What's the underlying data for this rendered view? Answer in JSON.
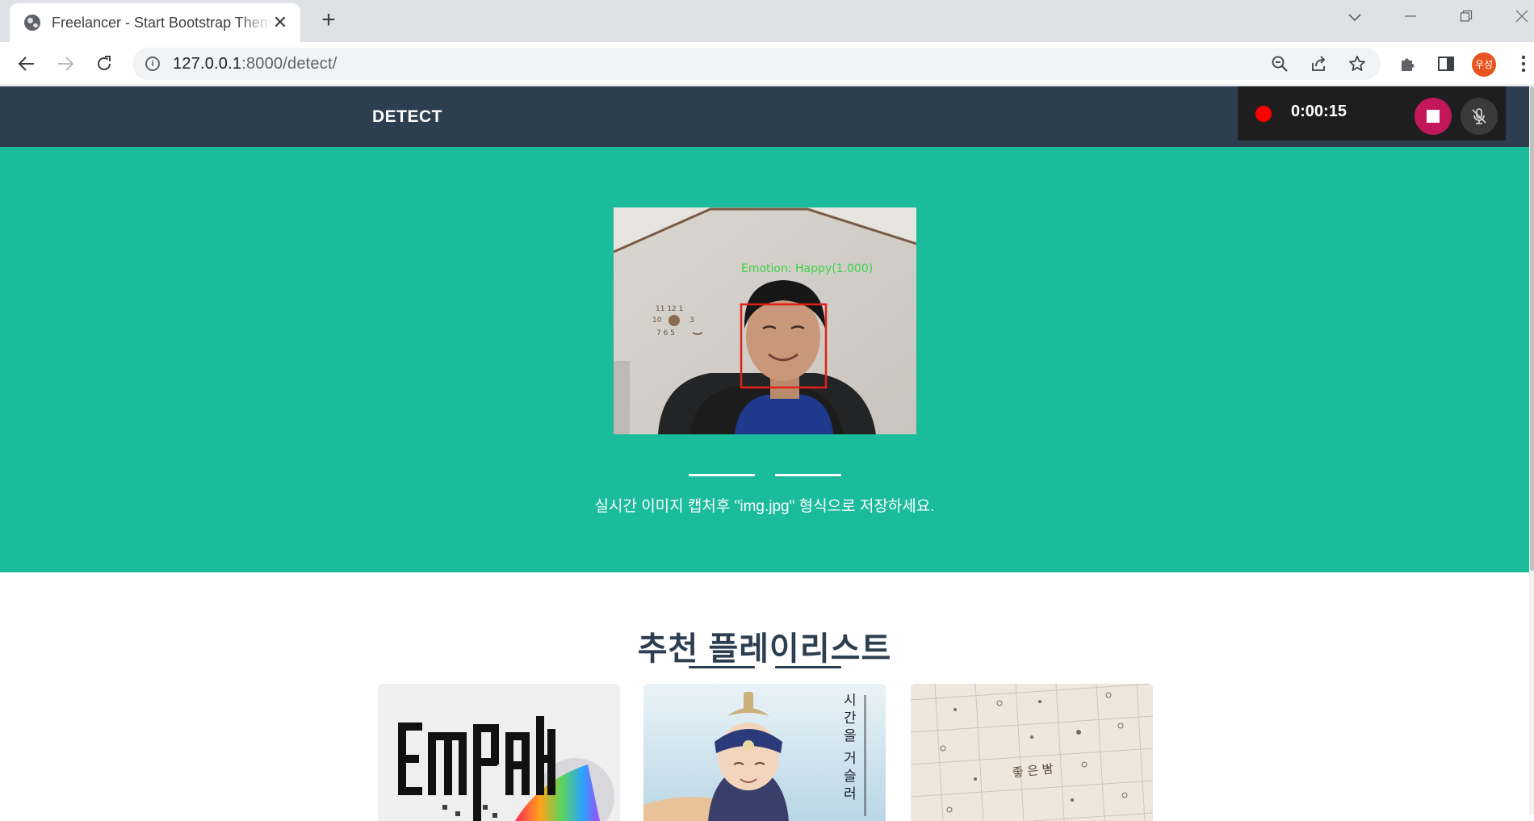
{
  "browser": {
    "tab_title": "Freelancer - Start Bootstrap Theme",
    "url_host": "127.0.0.1",
    "url_path": ":8000/detect/",
    "profile_initials": "우성"
  },
  "navbar": {
    "brand": "DETECT"
  },
  "recorder": {
    "elapsed": "0:00:15"
  },
  "detection": {
    "overlay_label": "Emotion: Happy(1.000)",
    "box_color": "#e0201a",
    "label_color": "#3fd14a"
  },
  "masthead": {
    "instruction": "실시간 이미지 캡처후 \"img.jpg\" 형식으로 저장하세요."
  },
  "playlist": {
    "title": "추천 플레이리스트",
    "cards": [
      {
        "name": "album-empathy"
      },
      {
        "name": "album-time-travel"
      },
      {
        "name": "album-good-night"
      }
    ]
  },
  "colors": {
    "navbar": "#2c3e50",
    "masthead": "#1abc9c",
    "record_dot": "#ff0000",
    "stop_button": "#c2185b"
  }
}
